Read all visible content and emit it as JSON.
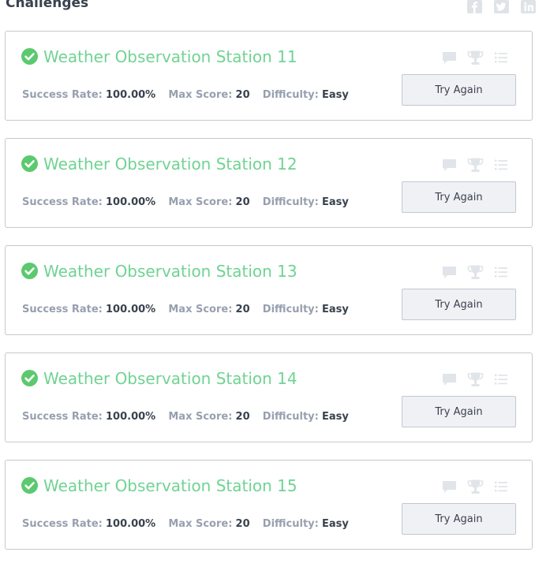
{
  "header": {
    "title": "Challenges",
    "share_icons": [
      "facebook-icon",
      "twitter-icon",
      "linkedin-icon"
    ]
  },
  "colors": {
    "solved_green": "#5cc96f",
    "title_green": "#70d393",
    "icon_gray": "#e1e4e8",
    "label_gray": "#979faf"
  },
  "labels": {
    "success_rate": "Success Rate:",
    "max_score": "Max Score:",
    "difficulty": "Difficulty:",
    "try_again": "Try Again"
  },
  "challenges": [
    {
      "name": "Weather Observation Station 11",
      "success_rate": "100.00%",
      "max_score": "20",
      "difficulty": "Easy"
    },
    {
      "name": "Weather Observation Station 12",
      "success_rate": "100.00%",
      "max_score": "20",
      "difficulty": "Easy"
    },
    {
      "name": "Weather Observation Station 13",
      "success_rate": "100.00%",
      "max_score": "20",
      "difficulty": "Easy"
    },
    {
      "name": "Weather Observation Station 14",
      "success_rate": "100.00%",
      "max_score": "20",
      "difficulty": "Easy"
    },
    {
      "name": "Weather Observation Station 15",
      "success_rate": "100.00%",
      "max_score": "20",
      "difficulty": "Easy"
    }
  ]
}
